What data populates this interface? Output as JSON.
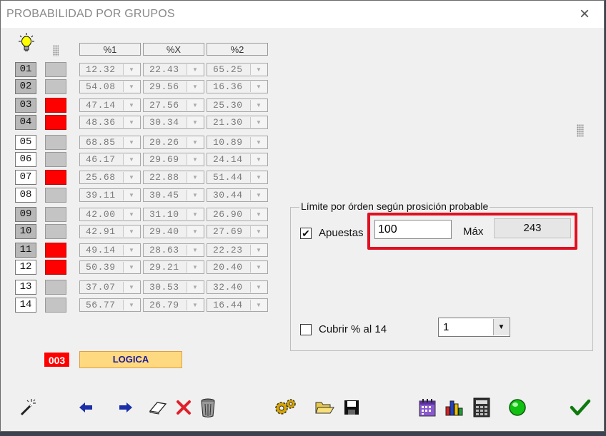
{
  "window": {
    "title": "PROBABILIDAD POR GRUPOS",
    "close_label": "×"
  },
  "headers": [
    "%1",
    "%X",
    "%2"
  ],
  "rows": [
    {
      "num": "01",
      "num_style": "gray",
      "marker": "gray",
      "p1": "12.32",
      "px": "22.43",
      "p2": "65.25"
    },
    {
      "num": "02",
      "num_style": "gray",
      "marker": "gray",
      "p1": "54.08",
      "px": "29.56",
      "p2": "16.36"
    },
    {
      "num": "03",
      "num_style": "gray",
      "marker": "red",
      "p1": "47.14",
      "px": "27.56",
      "p2": "25.30"
    },
    {
      "num": "04",
      "num_style": "gray",
      "marker": "red",
      "p1": "48.36",
      "px": "30.34",
      "p2": "21.30"
    },
    {
      "num": "05",
      "num_style": "white",
      "marker": "gray",
      "p1": "68.85",
      "px": "20.26",
      "p2": "10.89"
    },
    {
      "num": "06",
      "num_style": "white",
      "marker": "gray",
      "p1": "46.17",
      "px": "29.69",
      "p2": "24.14"
    },
    {
      "num": "07",
      "num_style": "white",
      "marker": "red",
      "p1": "25.68",
      "px": "22.88",
      "p2": "51.44"
    },
    {
      "num": "08",
      "num_style": "white",
      "marker": "gray",
      "p1": "39.11",
      "px": "30.45",
      "p2": "30.44"
    },
    {
      "num": "09",
      "num_style": "gray",
      "marker": "gray",
      "p1": "42.00",
      "px": "31.10",
      "p2": "26.90"
    },
    {
      "num": "10",
      "num_style": "gray",
      "marker": "gray",
      "p1": "42.91",
      "px": "29.40",
      "p2": "27.69"
    },
    {
      "num": "11",
      "num_style": "gray",
      "marker": "red",
      "p1": "49.14",
      "px": "28.63",
      "p2": "22.23"
    },
    {
      "num": "12",
      "num_style": "white",
      "marker": "red",
      "p1": "50.39",
      "px": "29.21",
      "p2": "20.40"
    },
    {
      "num": "13",
      "num_style": "white",
      "marker": "gray",
      "p1": "37.07",
      "px": "30.53",
      "p2": "32.40"
    },
    {
      "num": "14",
      "num_style": "white",
      "marker": "gray",
      "p1": "56.77",
      "px": "26.79",
      "p2": "16.44"
    }
  ],
  "counter": "003",
  "logic_button": "LOGICA",
  "limit_group": {
    "legend": "Límite por órden según prosición probable",
    "apuestas_checked": true,
    "apuestas_label": "Apuestas",
    "apuestas_value": "100",
    "max_label": "Máx",
    "max_value": "243",
    "cubrir_checked": false,
    "cubrir_label": "Cubrir % al 14",
    "cubrir_select_value": "1"
  },
  "toolbar": [
    "magic-wand-icon",
    "arrow-left-icon",
    "arrow-right-icon",
    "eraser-icon",
    "delete-x-icon",
    "trash-can-icon",
    "gears-icon",
    "open-folder-icon",
    "save-disk-icon",
    "calendar-icon",
    "bar-chart-icon",
    "calculator-icon",
    "green-light-icon",
    "checkmark-icon"
  ],
  "colors": {
    "marker_red": "#ff0000",
    "logic_bg": "#ffd980",
    "logic_text": "#1a1aa0",
    "highlight": "#e01020"
  }
}
